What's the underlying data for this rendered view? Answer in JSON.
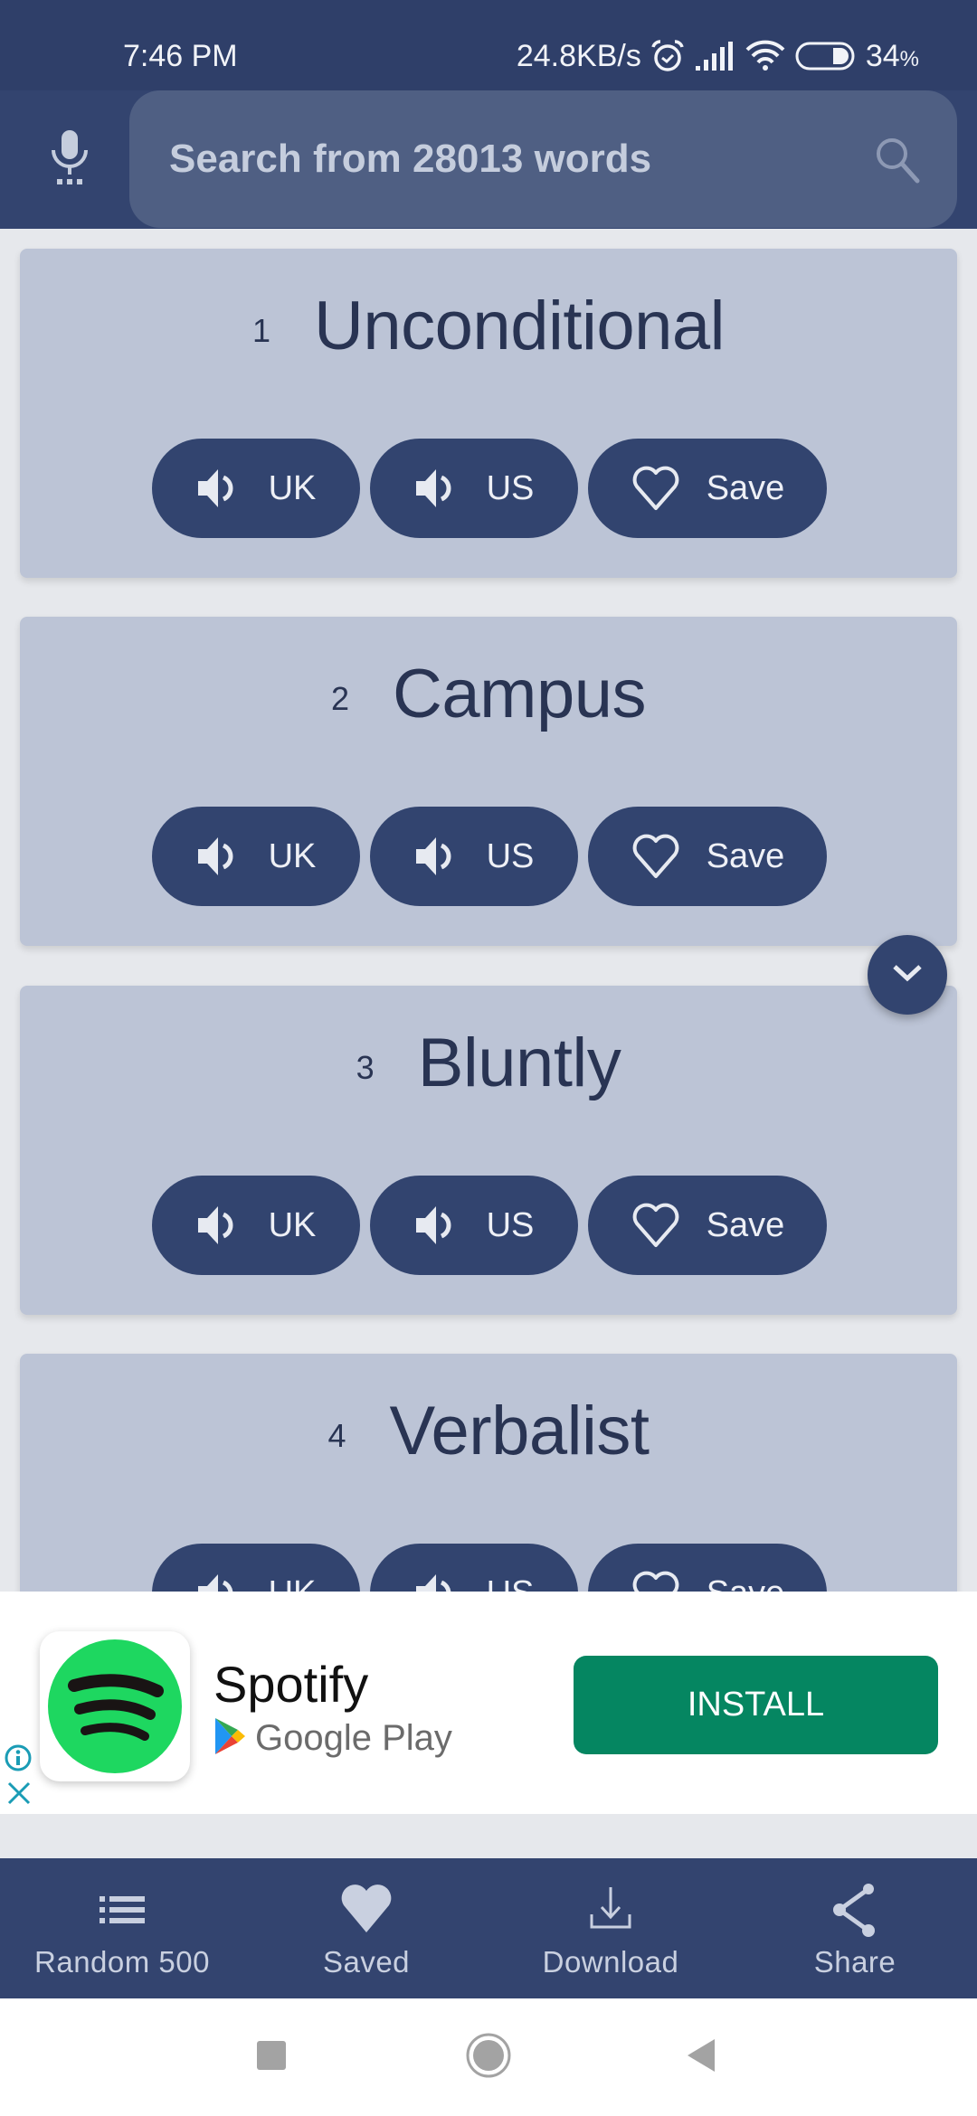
{
  "status_bar": {
    "time": "7:46 PM",
    "net_speed": "24.8KB/s",
    "battery_percent": "34",
    "battery_suffix": "%",
    "icons": [
      "alarm-icon",
      "signal-icon",
      "wifi-icon",
      "battery-icon"
    ]
  },
  "header": {
    "mic_icon": "mic-icon",
    "search_placeholder": "Search from 28013 words",
    "search_value": "",
    "search_icon": "search-icon"
  },
  "words": [
    {
      "number": "1",
      "word": "Unconditional",
      "uk_label": "UK",
      "us_label": "US",
      "save_label": "Save"
    },
    {
      "number": "2",
      "word": "Campus",
      "uk_label": "UK",
      "us_label": "US",
      "save_label": "Save"
    },
    {
      "number": "3",
      "word": "Bluntly",
      "uk_label": "UK",
      "us_label": "US",
      "save_label": "Save"
    },
    {
      "number": "4",
      "word": "Verbalist",
      "uk_label": "UK",
      "us_label": "US",
      "save_label": "Save"
    }
  ],
  "fab": {
    "icon": "chevron-down-icon"
  },
  "ad": {
    "app_name": "Spotify",
    "store": "Google Play",
    "install_label": "INSTALL",
    "install_color": "#058661"
  },
  "bottom_nav": [
    {
      "label": "Random 500",
      "icon": "list-icon"
    },
    {
      "label": "Saved",
      "icon": "heart-icon"
    },
    {
      "label": "Download",
      "icon": "download-icon"
    },
    {
      "label": "Share",
      "icon": "share-icon"
    }
  ],
  "colors": {
    "primary": "#33446f",
    "card": "#bcc4d6",
    "background": "#e6e8ec",
    "ad_info": "#1a9cb5"
  }
}
